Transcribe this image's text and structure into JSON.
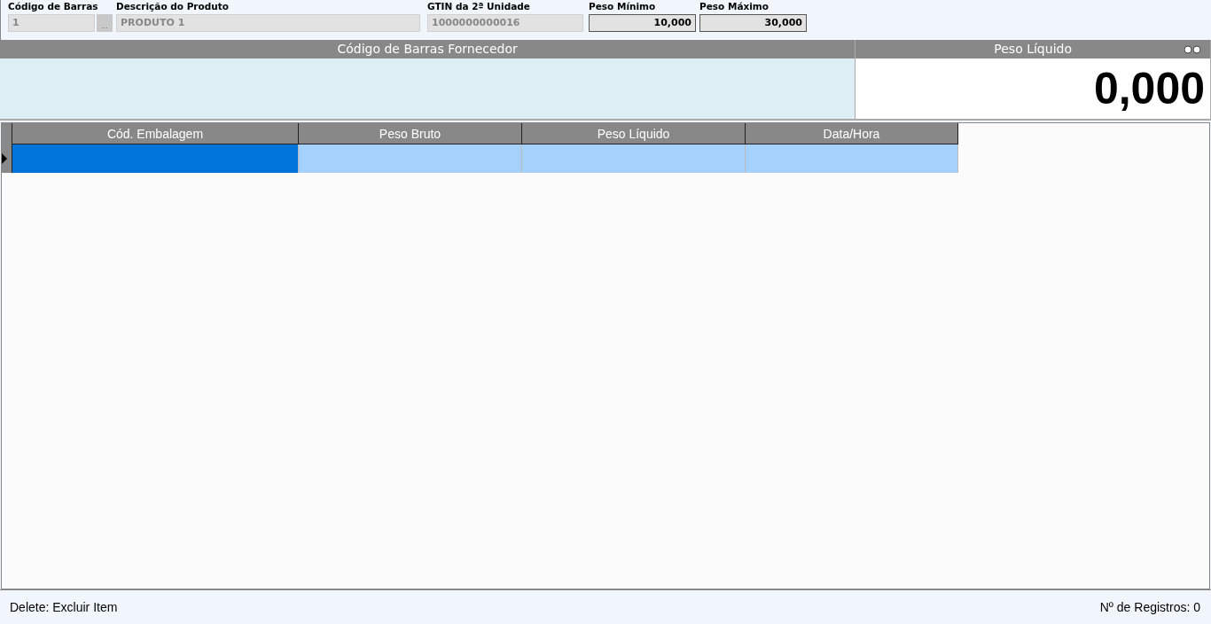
{
  "header_fields": [
    {
      "label": "Código de Barras",
      "value": "1",
      "kind": "lookup",
      "disabled": true
    },
    {
      "label": "Descrição do Produto",
      "value": "PRODUTO 1",
      "kind": "text",
      "disabled": true
    },
    {
      "label": "GTIN da 2ª Unidade",
      "value": "1000000000016",
      "kind": "text",
      "disabled": true
    },
    {
      "label": "Peso Mínimo",
      "value": "10,000",
      "kind": "number",
      "disabled": false
    },
    {
      "label": "Peso Máximo",
      "value": "30,000",
      "kind": "number",
      "disabled": false
    }
  ],
  "lookup_button": "...",
  "barcode_panel": {
    "title": "Código de Barras Fornecedor"
  },
  "weight_panel": {
    "title": "Peso Líquido",
    "value": "0,000"
  },
  "table": {
    "columns": [
      "Cód. Embalagem",
      "Peso Bruto",
      "Peso Líquido",
      "Data/Hora"
    ],
    "rows": [
      {
        "selected": true,
        "cells": [
          {
            "focused": true
          },
          {
            "focused": false
          },
          {
            "focused": false
          },
          {
            "focused": false
          }
        ]
      }
    ]
  },
  "status_bar": {
    "hint": "Delete: Excluir Item",
    "count": "Nº de Registros: 0"
  }
}
